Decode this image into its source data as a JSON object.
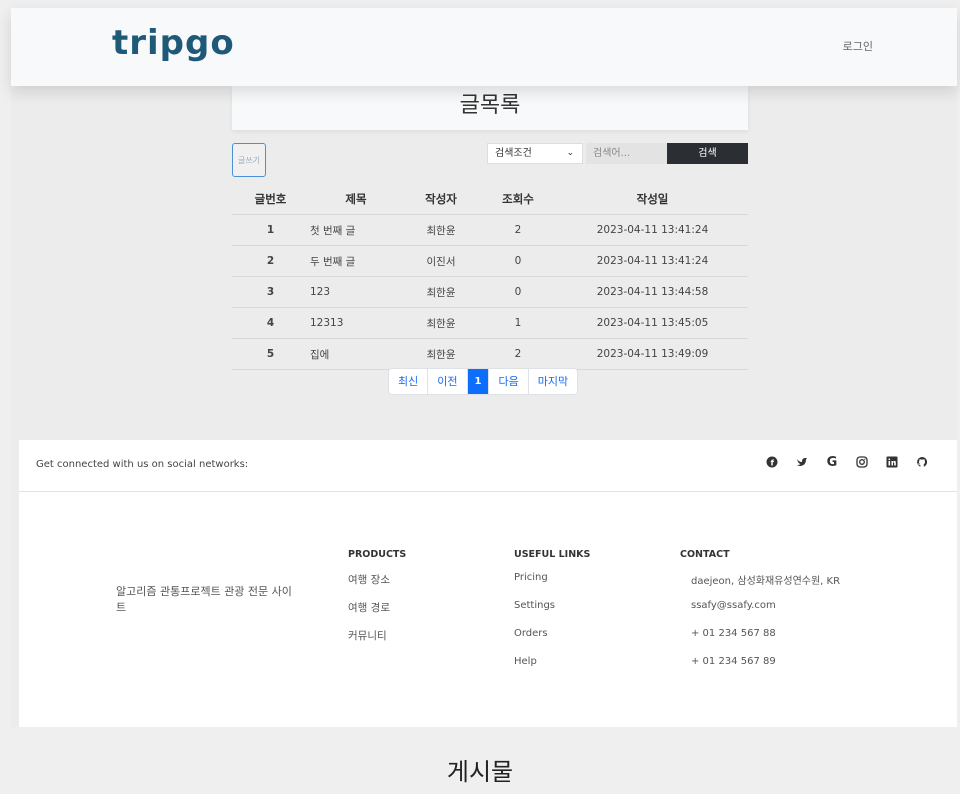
{
  "navbar": {
    "logo": "tripgo",
    "login": "로그인"
  },
  "board": {
    "title": "글목록",
    "write_label": "글쓰기",
    "search": {
      "condition_selected": "검색조건",
      "placeholder": "검색어...",
      "button": "검색"
    },
    "columns": [
      "글번호",
      "제목",
      "작성자",
      "조회수",
      "작성일"
    ],
    "rows": [
      {
        "no": "1",
        "title": "첫 번째 글",
        "author": "최한윤",
        "views": "2",
        "date": "2023-04-11 13:41:24"
      },
      {
        "no": "2",
        "title": "두 번째 글",
        "author": "이진서",
        "views": "0",
        "date": "2023-04-11 13:41:24"
      },
      {
        "no": "3",
        "title": "123",
        "author": "최한윤",
        "views": "0",
        "date": "2023-04-11 13:44:58"
      },
      {
        "no": "4",
        "title": "12313",
        "author": "최한윤",
        "views": "1",
        "date": "2023-04-11 13:45:05"
      },
      {
        "no": "5",
        "title": "집에",
        "author": "최한윤",
        "views": "2",
        "date": "2023-04-11 13:49:09"
      }
    ],
    "pagination": {
      "first": "최신",
      "prev": "이전",
      "current": "1",
      "next": "다음",
      "last": "마지막"
    }
  },
  "social": {
    "text": "Get connected with us on social networks:",
    "icons": [
      "facebook-icon",
      "twitter-icon",
      "google-icon",
      "instagram-icon",
      "linkedin-icon",
      "github-icon"
    ]
  },
  "footer": {
    "about": "알고리즘 관통프로젝트 관광 전문 사이트",
    "products": {
      "heading": "PRODUCTS",
      "items": [
        "여행 장소",
        "여행 경로",
        "커뮤니티"
      ]
    },
    "useful": {
      "heading": "USEFUL LINKS",
      "items": [
        "Pricing",
        "Settings",
        "Orders",
        "Help"
      ]
    },
    "contact": {
      "heading": "CONTACT",
      "items": [
        "daejeon, 삼성화재유성연수원, KR",
        "ssafy@ssafy.com",
        "+ 01 234 567 88",
        "+ 01 234 567 89"
      ]
    }
  },
  "caption": "게시물",
  "colors": {
    "logo": "#1e5a78",
    "primary": "#0d6efd",
    "search_button": "#2b2f33"
  }
}
